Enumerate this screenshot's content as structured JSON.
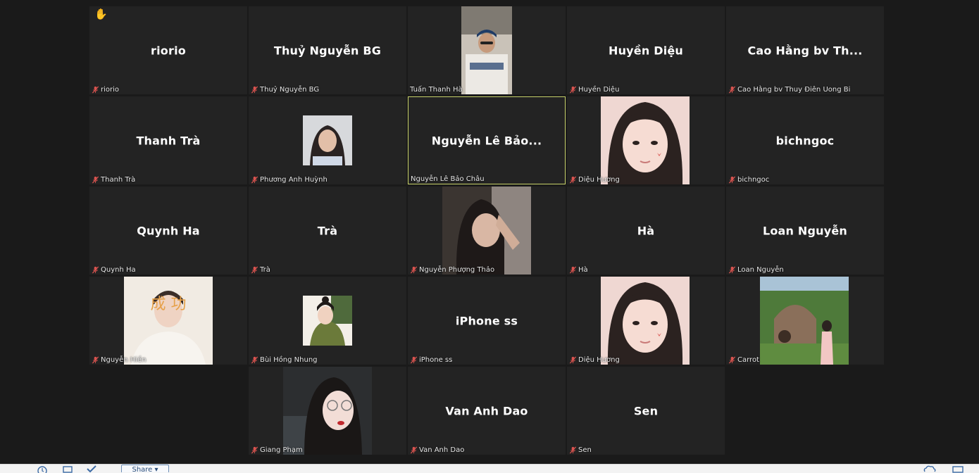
{
  "raised_hand_icon": "raised-hand-icon",
  "mic_icon": "mic-muted-icon",
  "accent_colors": {
    "active_speaker_border": "#c8d26a",
    "muted_mic": "#d9534f",
    "tile_bg": "#232323"
  },
  "tiles": [
    {
      "display": "riorio",
      "label": "riorio"
    },
    {
      "display": "Thuỷ Nguyễn BG",
      "label": "Thuỷ Nguyễn BG"
    },
    {
      "display": "",
      "label": "Tuấn Thanh Hà"
    },
    {
      "display": "Huyền Diệu",
      "label": "Huyền Diệu"
    },
    {
      "display": "Cao Hằng bv Th...",
      "label": "Cao Hằng bv Thuy Điên Uong Bi"
    },
    {
      "display": "Thanh Trà",
      "label": "Thanh Trà"
    },
    {
      "display": "",
      "label": "Phương Anh Huỳnh"
    },
    {
      "display": "Nguyễn Lê Bảo...",
      "label": "Nguyễn Lê Bảo Châu"
    },
    {
      "display": "",
      "label": "Diệu Hương"
    },
    {
      "display": "bichngoc",
      "label": "bichngoc"
    },
    {
      "display": "Quynh Ha",
      "label": "Quynh Ha"
    },
    {
      "display": "Trà",
      "label": "Trà"
    },
    {
      "display": "",
      "label": "Nguyễn Phượng Thảo"
    },
    {
      "display": "Hà",
      "label": "Hà"
    },
    {
      "display": "Loan Nguyễn",
      "label": "Loan Nguyễn"
    },
    {
      "display": "",
      "label": "Nguyễn Hiền",
      "image_text": "成 功"
    },
    {
      "display": "",
      "label": "Bùi Hồng Nhung"
    },
    {
      "display": "iPhone ss",
      "label": "iPhone ss"
    },
    {
      "display": "",
      "label": "Diệu Hương"
    },
    {
      "display": "",
      "label": "Carrot"
    },
    {
      "display": "",
      "label": "Giang Phạm"
    },
    {
      "display": "Van Anh Dao",
      "label": "Van Anh Dao"
    },
    {
      "display": "Sen",
      "label": "Sen"
    }
  ],
  "toolbar": {
    "share_label": "Share ▾"
  }
}
